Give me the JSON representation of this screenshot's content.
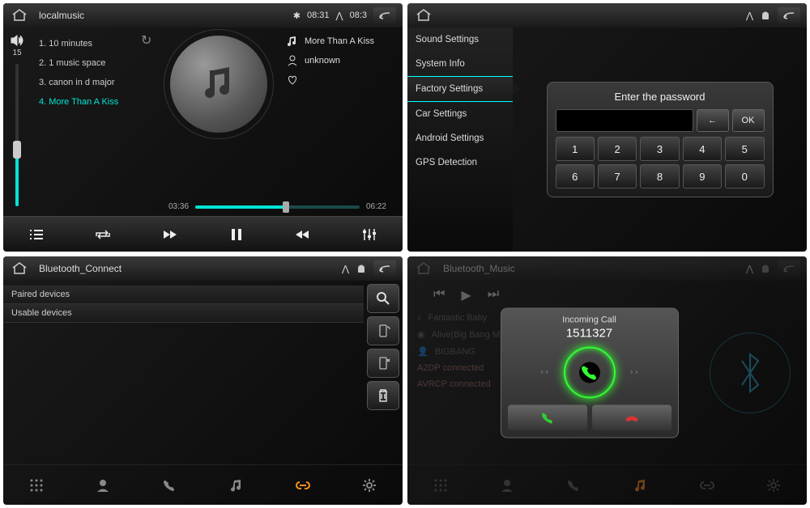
{
  "panel1": {
    "title": "localmusic",
    "time": "08:31",
    "time2": "08:3",
    "volume": "15",
    "tracks": [
      "1. 10 minutes",
      "2. 1 music space",
      "3. canon in d major",
      "4. More Than A Kiss"
    ],
    "active_track_index": 3,
    "now_playing": "More Than A Kiss",
    "artist": "unknown",
    "elapsed": "03:36",
    "duration": "06:22"
  },
  "panel2": {
    "menu": [
      "Sound Settings",
      "System Info",
      "Factory Settings",
      "Car Settings",
      "Android Settings",
      "GPS Detection"
    ],
    "selected_index": 2,
    "dialog_title": "Enter the password",
    "back_label": "←",
    "ok_label": "OK",
    "keys": [
      "1",
      "2",
      "3",
      "4",
      "5",
      "6",
      "7",
      "8",
      "9",
      "0"
    ]
  },
  "panel3": {
    "title": "Bluetooth_Connect",
    "sections": [
      "Paired devices",
      "Usable devices"
    ]
  },
  "panel4": {
    "title": "Bluetooth_Music",
    "bg_tracks": {
      "t1": "Fantastic Baby",
      "t2": "Alive(Big Bang Mini Album Vol...",
      "t3": "BIGBANG",
      "s1": "A2DP connected",
      "s2": "AVRCP connected"
    },
    "call_title": "Incoming Call",
    "call_number": "1511327"
  }
}
